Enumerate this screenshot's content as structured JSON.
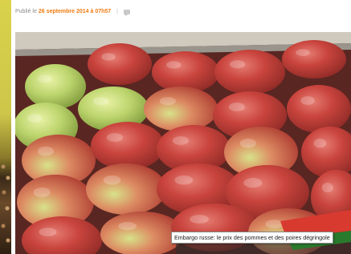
{
  "post": {
    "published_prefix": "Publié le",
    "published_date": "26 septembre 2014 à 07h57",
    "separator": "|",
    "comment_icon": "comment-icon"
  },
  "image": {
    "subject": "apples-in-crate",
    "caption_tooltip": "Embargo russe: le prix des pommes et des poires dégringole"
  },
  "colors": {
    "date_accent": "#f07a10",
    "meta_text": "#8a8a8a"
  }
}
